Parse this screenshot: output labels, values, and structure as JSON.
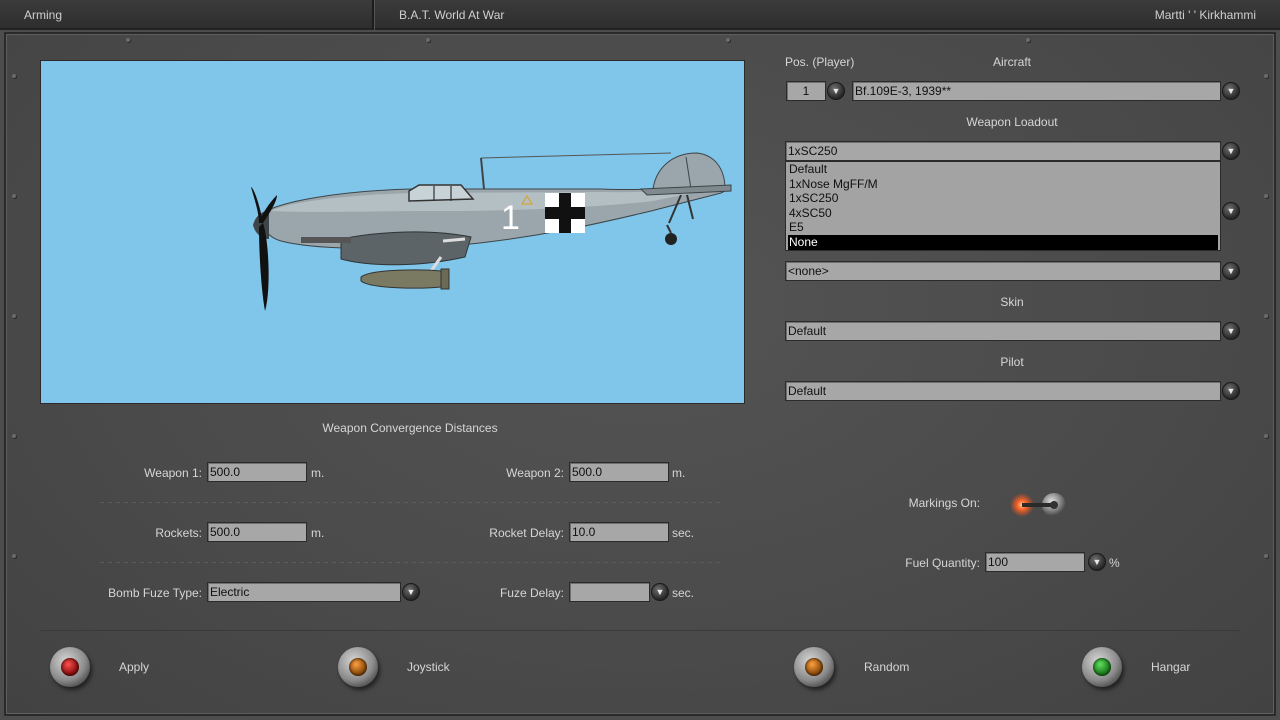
{
  "titlebar": {
    "screen_name": "Arming",
    "app_title": "B.A.T. World At War",
    "player_name": "Martti ' ' Kirkhammi"
  },
  "preview": {
    "fuselage_number": "1"
  },
  "aircraft_section": {
    "pos_label": "Pos. (Player)",
    "pos_value": "1",
    "aircraft_label": "Aircraft",
    "aircraft_value": "Bf.109E-3, 1939**",
    "loadout_label": "Weapon Loadout",
    "loadout_value": "1xSC250",
    "loadout_options": [
      "Default",
      "1xNose MgFF/M",
      "1xSC250",
      "4xSC50",
      "E5",
      "None"
    ],
    "loadout_highlighted": "None",
    "extra_value": "<none>",
    "skin_label": "Skin",
    "skin_value": "Default",
    "pilot_label": "Pilot",
    "pilot_value": "Default"
  },
  "convergence": {
    "title": "Weapon Convergence Distances",
    "weapon1_label": "Weapon 1:",
    "weapon1_value": "500.0",
    "weapon2_label": "Weapon 2:",
    "weapon2_value": "500.0",
    "rockets_label": "Rockets:",
    "rockets_value": "500.0",
    "rocket_delay_label": "Rocket Delay:",
    "rocket_delay_value": "10.0",
    "bomb_fuze_label": "Bomb Fuze Type:",
    "bomb_fuze_value": "Electric",
    "fuze_delay_label": "Fuze Delay:",
    "fuze_delay_value": "",
    "unit_m": "m.",
    "unit_sec": "sec."
  },
  "options": {
    "markings_label": "Markings On:",
    "markings_on": true,
    "fuel_label": "Fuel Quantity:",
    "fuel_value": "100",
    "fuel_unit": "%"
  },
  "buttons": {
    "apply": "Apply",
    "joystick": "Joystick",
    "random": "Random",
    "hangar": "Hangar"
  },
  "colors": {
    "preview_sky": "#80c6ea",
    "apply_lamp": "#8a1010",
    "joystick_lamp": "#8a4a0a",
    "random_lamp": "#8a4a0a",
    "hangar_lamp": "#1a7a1a",
    "markings_lamp": "#ff6a2a"
  },
  "icons": {
    "dropdown": "chevron-down-icon",
    "aircraft": "aircraft-icon"
  }
}
